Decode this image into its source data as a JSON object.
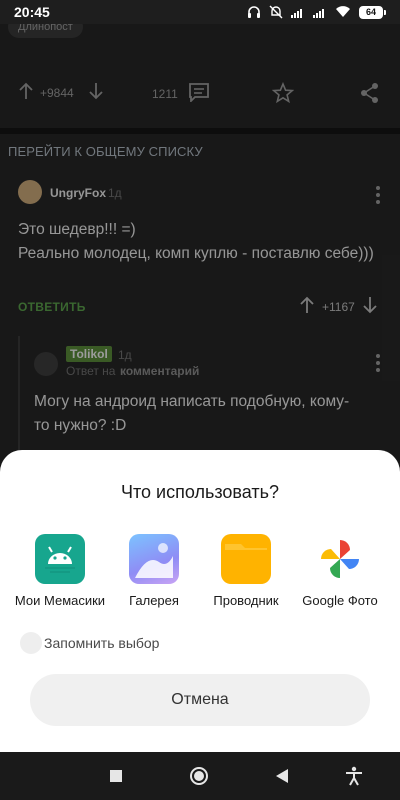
{
  "status_bar": {
    "time": "20:45",
    "battery": "64"
  },
  "post": {
    "chip_text": "Длинопост",
    "rating": "+9844",
    "comments_count": "1211",
    "back_link": "ПЕРЕЙТИ К ОБЩЕМУ СПИСКУ"
  },
  "comments": [
    {
      "author": "UngryFox",
      "time": "1д",
      "text": "Это шедевр!!! =)\nРеально молодец, комп куплю - поставлю себе)))",
      "reply_label": "ОТВЕТИТЬ",
      "rating": "+1167"
    },
    {
      "author": "Tolikol",
      "time": "1д",
      "reply_prefix": "Ответ на",
      "reply_target": "комментарий",
      "text": "Могу на андроид написать подобную, кому-то нужно? :D"
    }
  ],
  "chooser": {
    "title": "Что использовать?",
    "apps": [
      {
        "label": "Мои Мемасики",
        "icon": "android-app-icon",
        "color": "#17a68e"
      },
      {
        "label": "Галерея",
        "icon": "gallery-icon",
        "color": "#7aa6f2"
      },
      {
        "label": "Проводник",
        "icon": "folder-icon",
        "color": "#ffb300"
      },
      {
        "label": "Google Фото",
        "icon": "google-photos-icon",
        "color": "#ea4335"
      }
    ],
    "remember_label": "Запомнить выбор",
    "cancel_label": "Отмена"
  }
}
